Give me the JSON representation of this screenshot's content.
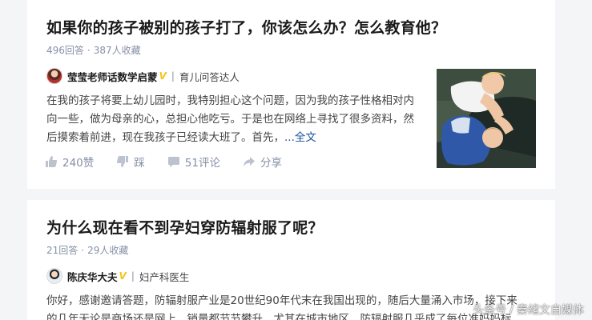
{
  "questions": [
    {
      "title": "如果你的孩子被别的孩子打了，你该怎么办？怎么教育他？",
      "answers": "496回答",
      "dot": "·",
      "favorites": "387人收藏",
      "author": {
        "name": "莹莹老师话数学启蒙",
        "verified": "V",
        "sep": "|",
        "tag": "育儿问答达人"
      },
      "excerpt": "在我的孩子将要上幼儿园时，我特别担心这个问题，因为我的孩子性格相对内向一些，做为母亲的心，总担心他吃亏。于是也在网络上寻找了很多资料，然后摸索着前进，现在我孩子已经读大班了。首先，",
      "read_more": "...全文",
      "actions": {
        "like": "240赞",
        "dislike": "踩",
        "comments": "51评论",
        "share": "分享"
      }
    },
    {
      "title": "为什么现在看不到孕妇穿防辐射服了呢？",
      "answers": "21回答",
      "dot": "·",
      "favorites": "29人收藏",
      "author": {
        "name": "陈庆华大夫",
        "verified": "V",
        "sep": "|",
        "tag": "妇产科医生"
      },
      "excerpt_line1": "你好，感谢邀请答题，防辐射服产业是20世纪90年代末在我国出现的，随后大量涌入市场，接下来",
      "excerpt_line2": "的几年无论是商场还是网上，销量都节节攀升，尤其在城市地区，防辐射服几乎成了每位准妈妈标"
    }
  ],
  "watermark": {
    "platform": "头条号",
    "sep": "/",
    "account": "秦绪文自媒体"
  },
  "colors": {
    "background": "#f4f5f7",
    "link": "#175199",
    "meta": "#8590a6",
    "verified_badge": "#f5c518"
  }
}
